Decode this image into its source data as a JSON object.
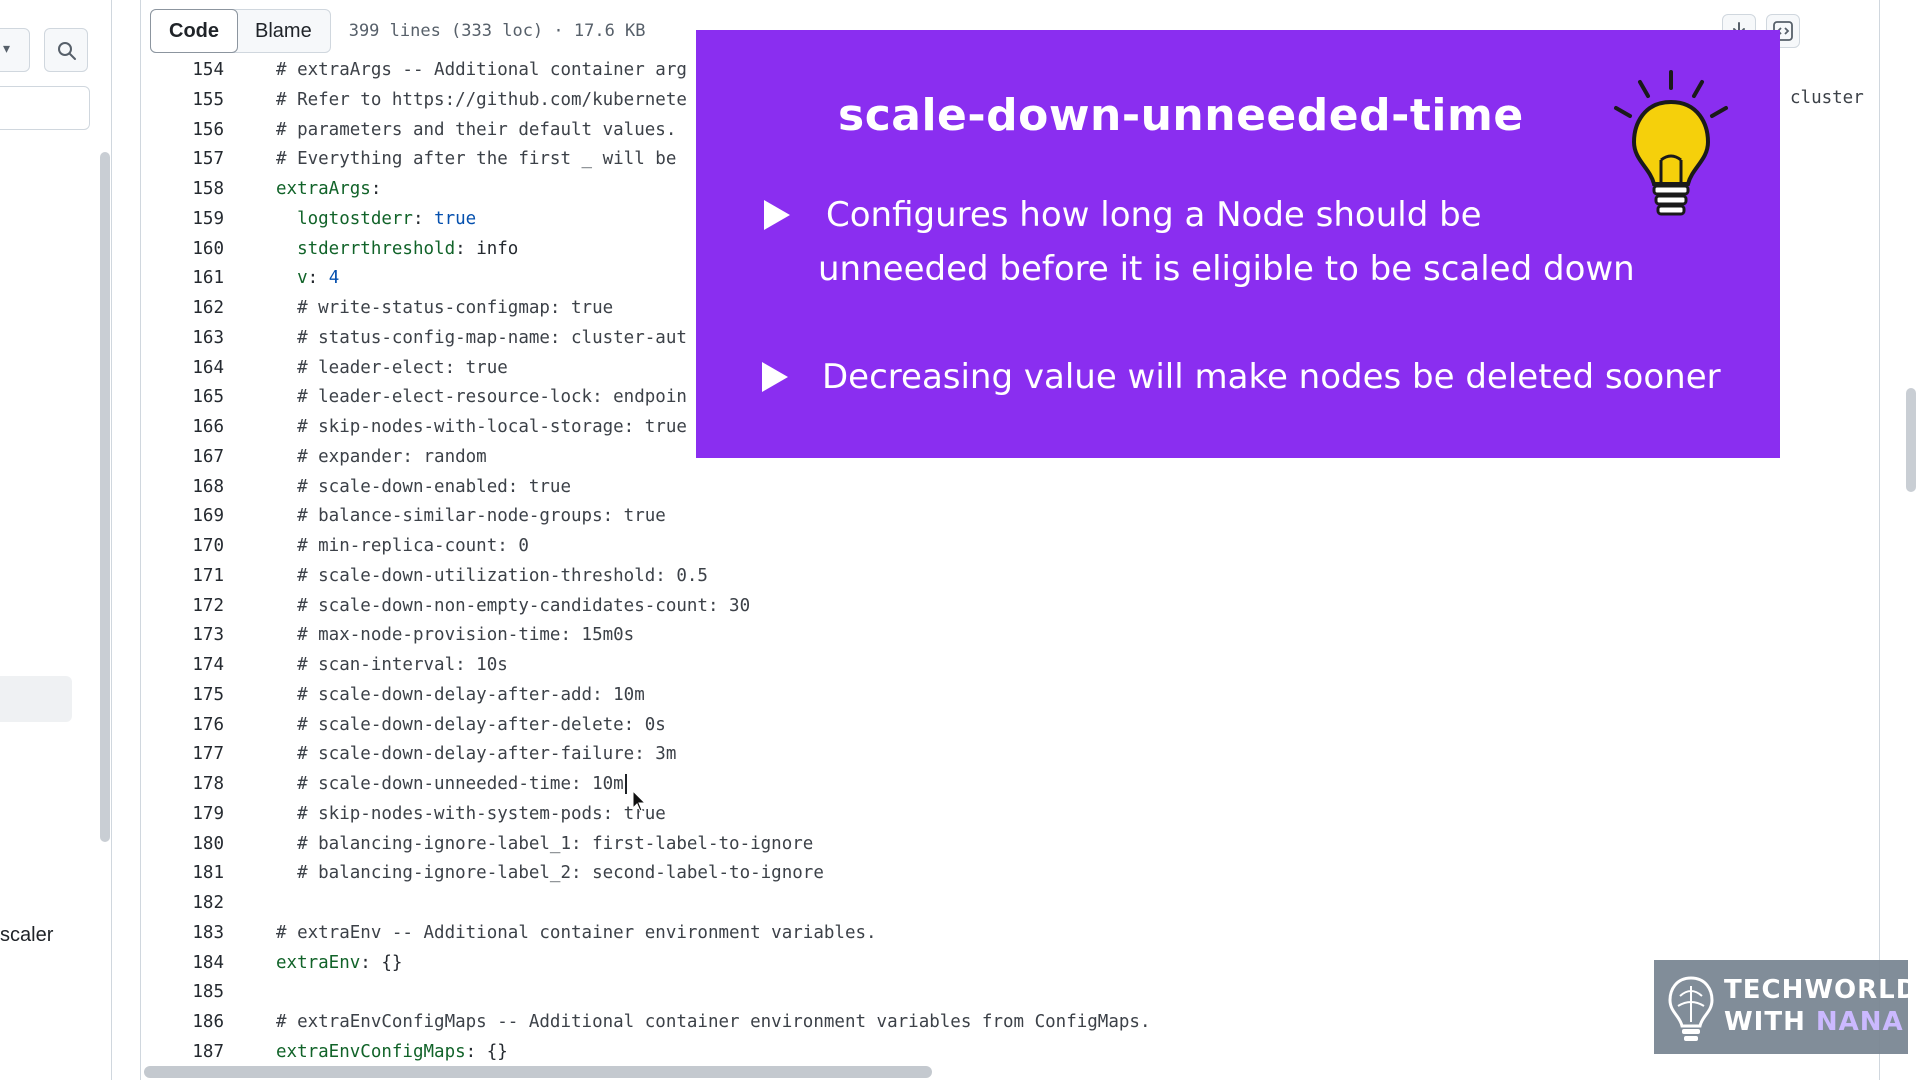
{
  "sidebar": {
    "bottom_label": "scaler"
  },
  "toolbar": {
    "code_tab": "Code",
    "blame_tab": "Blame",
    "file_info": "399 lines (333 loc) · 17.6 KB"
  },
  "code": {
    "stray_right_text": "cluster",
    "lines": [
      {
        "n": "154",
        "t": "# extraArgs -- Additional container arg"
      },
      {
        "n": "155",
        "t": "# Refer to https://github.com/kubernete"
      },
      {
        "n": "156",
        "t": "# parameters and their default values."
      },
      {
        "n": "157",
        "t": "# Everything after the first _ will be"
      },
      {
        "n": "158",
        "key": "extraArgs",
        "sep": ":",
        "val": "",
        "indent": ""
      },
      {
        "n": "159",
        "key": "logtostderr",
        "sep": ": ",
        "val": "true",
        "indent": "  "
      },
      {
        "n": "160",
        "key": "stderrthreshold",
        "sep": ": ",
        "val": "info",
        "indent": "  ",
        "plain": true
      },
      {
        "n": "161",
        "key": "v",
        "sep": ": ",
        "val": "4",
        "indent": "  "
      },
      {
        "n": "162",
        "t": "  # write-status-configmap: true"
      },
      {
        "n": "163",
        "t": "  # status-config-map-name: cluster-aut"
      },
      {
        "n": "164",
        "t": "  # leader-elect: true"
      },
      {
        "n": "165",
        "t": "  # leader-elect-resource-lock: endpoin"
      },
      {
        "n": "166",
        "t": "  # skip-nodes-with-local-storage: true"
      },
      {
        "n": "167",
        "t": "  # expander: random"
      },
      {
        "n": "168",
        "t": "  # scale-down-enabled: true"
      },
      {
        "n": "169",
        "t": "  # balance-similar-node-groups: true"
      },
      {
        "n": "170",
        "t": "  # min-replica-count: 0"
      },
      {
        "n": "171",
        "t": "  # scale-down-utilization-threshold: 0.5"
      },
      {
        "n": "172",
        "t": "  # scale-down-non-empty-candidates-count: 30"
      },
      {
        "n": "173",
        "t": "  # max-node-provision-time: 15m0s"
      },
      {
        "n": "174",
        "t": "  # scan-interval: 10s"
      },
      {
        "n": "175",
        "t": "  # scale-down-delay-after-add: 10m"
      },
      {
        "n": "176",
        "t": "  # scale-down-delay-after-delete: 0s"
      },
      {
        "n": "177",
        "t": "  # scale-down-delay-after-failure: 3m"
      },
      {
        "n": "178",
        "t": "  # scale-down-unneeded-time: 10m",
        "caret": true
      },
      {
        "n": "179",
        "t": "  # skip-nodes-with-system-pods: true"
      },
      {
        "n": "180",
        "t": "  # balancing-ignore-label_1: first-label-to-ignore"
      },
      {
        "n": "181",
        "t": "  # balancing-ignore-label_2: second-label-to-ignore"
      },
      {
        "n": "182",
        "t": ""
      },
      {
        "n": "183",
        "t": "# extraEnv -- Additional container environment variables."
      },
      {
        "n": "184",
        "key": "extraEnv",
        "sep": ": ",
        "val": "{}",
        "indent": "",
        "plain": true
      },
      {
        "n": "185",
        "t": ""
      },
      {
        "n": "186",
        "t": "# extraEnvConfigMaps -- Additional container environment variables from ConfigMaps."
      },
      {
        "n": "187",
        "key": "extraEnvConfigMaps",
        "sep": ": ",
        "val": "{}",
        "indent": "",
        "plain": true
      }
    ]
  },
  "overlay": {
    "title": "scale-down-unneeded-time",
    "bullet1_line1": "Configures how long a Node should be",
    "bullet1_line2": "unneeded before it is eligible to be scaled down",
    "bullet2": "Decreasing value will make nodes be deleted sooner",
    "icon": "lightbulb-icon",
    "background_color": "#8a2ef0"
  },
  "logo": {
    "line1": "TECHWORLD",
    "line2_a": "WITH ",
    "line2_b": "NANA"
  }
}
